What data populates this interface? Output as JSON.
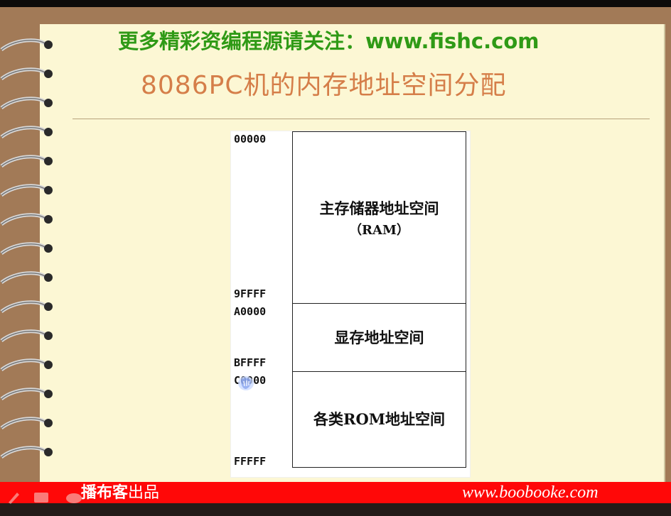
{
  "header": {
    "promo": "更多精彩资编程源请关注：www.fishc.com",
    "title": "8086PC机的内存地址空间分配"
  },
  "diagram": {
    "addresses": [
      "00000",
      "9FFFF",
      "A0000",
      "BFFFF",
      "C0000",
      "FFFFF"
    ],
    "blocks": [
      {
        "label": "主存储器地址空间",
        "sublabel": "（RAM）"
      },
      {
        "label": "显存地址空间"
      },
      {
        "label": "各类ROM地址空间"
      }
    ]
  },
  "footer": {
    "brand": "播布客",
    "brand_suffix": "出品",
    "url": "www.boobooke.com"
  },
  "colors": {
    "wood": "#a27a57",
    "paper": "#fcf7d4",
    "promo_green": "#2f9a16",
    "title_orange": "#d57e49",
    "footer_red": "#ff0808"
  },
  "icons": [
    "spiral-ring-icon",
    "pen-icon",
    "note-icon",
    "eraser-icon",
    "hand-cursor-icon"
  ]
}
